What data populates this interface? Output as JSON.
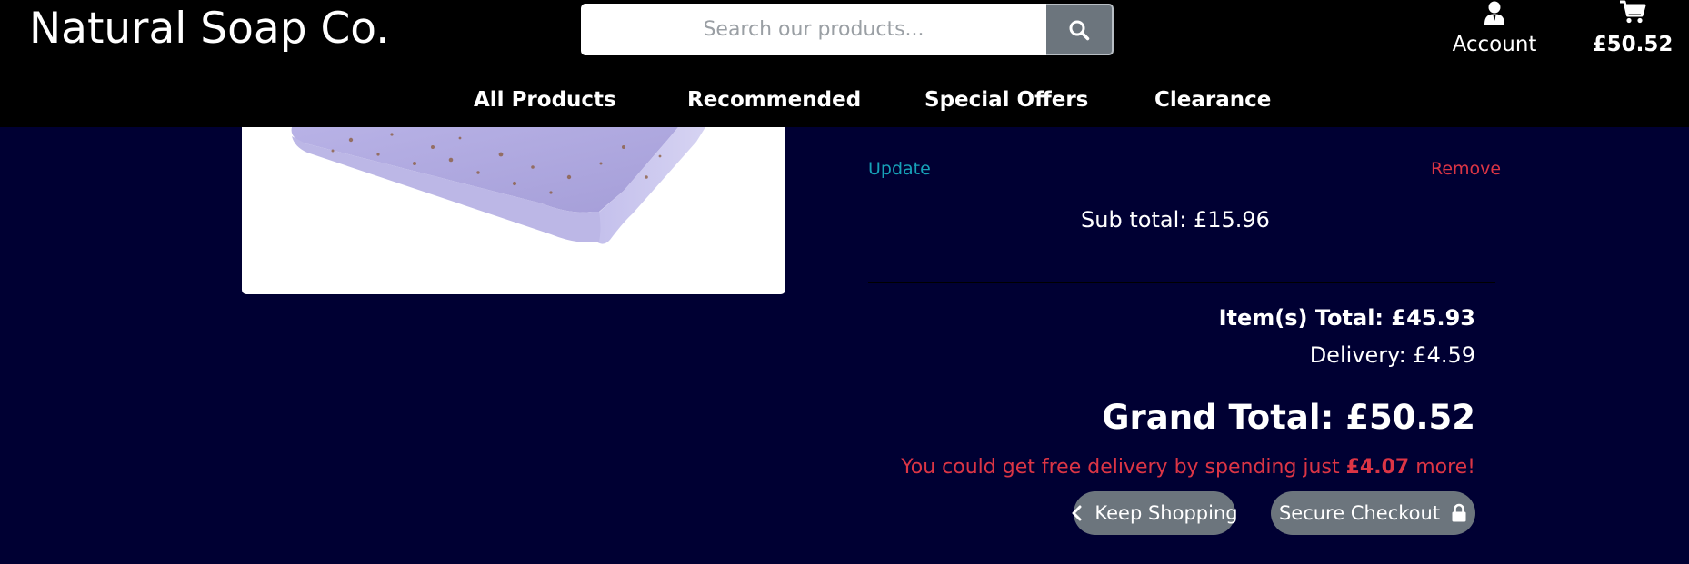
{
  "header": {
    "brand": "Natural Soap Co.",
    "search": {
      "placeholder": "Search our products..."
    },
    "account_label": "Account",
    "cart_total": "£50.52"
  },
  "nav": {
    "items": [
      "All Products",
      "Recommended",
      "Special Offers",
      "Clearance"
    ]
  },
  "basket_item": {
    "update_label": "Update",
    "remove_label": "Remove",
    "subtotal": "Sub total: £15.96"
  },
  "summary": {
    "items_total": "Item(s) Total: £45.93",
    "delivery": "Delivery: £4.59",
    "grand_total": "Grand Total: £50.52",
    "free_delivery_prefix": "You could get free delivery by spending just",
    "free_delivery_amount": "£4.07",
    "free_delivery_suffix": "more!"
  },
  "actions": {
    "keep_shopping": "Keep Shopping",
    "secure_checkout": "Secure Checkout"
  },
  "colors": {
    "page_background": "#000033",
    "header_background": "#000000",
    "update_link": "#17a2b8",
    "remove_link": "#dc3545",
    "button_gray": "#6c757d"
  },
  "icons": [
    "search-icon",
    "user-icon",
    "cart-icon",
    "chevron-left-icon",
    "lock-icon"
  ]
}
